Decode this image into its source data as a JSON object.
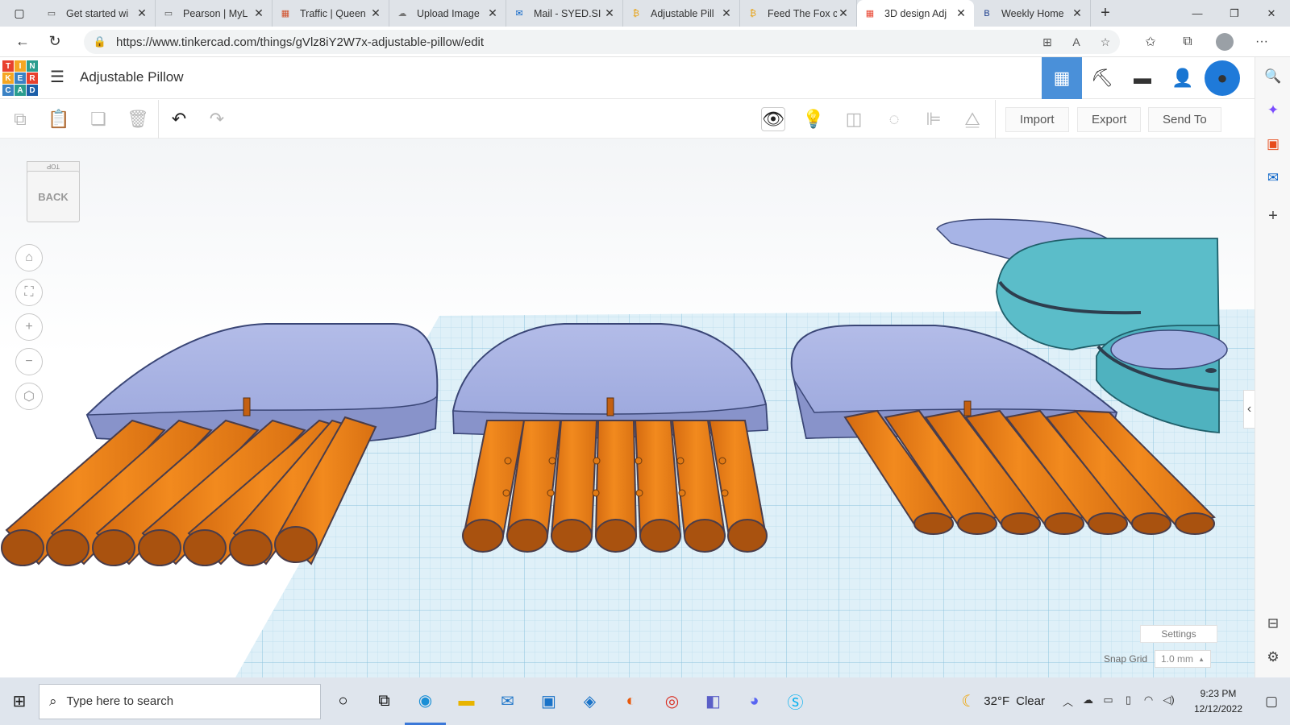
{
  "browser": {
    "tabs": [
      {
        "title": "Get started wi",
        "icon": "page-icon",
        "active": false
      },
      {
        "title": "Pearson | MyL",
        "icon": "page-icon",
        "active": false
      },
      {
        "title": "Traffic | Queen",
        "icon": "microsoft-icon",
        "active": false
      },
      {
        "title": "Upload Image",
        "icon": "cloud-icon",
        "active": false
      },
      {
        "title": "Mail - SYED.SI",
        "icon": "outlook-icon",
        "active": false
      },
      {
        "title": "Adjustable Pill",
        "icon": "coin-icon",
        "active": false
      },
      {
        "title": "Feed The Fox c",
        "icon": "coin-icon",
        "active": false
      },
      {
        "title": "3D design Adj",
        "icon": "tinkercad-icon",
        "active": true
      },
      {
        "title": "Weekly Home",
        "icon": "blackboard-icon",
        "active": false
      }
    ],
    "url": "https://www.tinkercad.com/things/gVlz8iY2W7x-adjustable-pillow/edit"
  },
  "app": {
    "logo_letters": [
      "T",
      "I",
      "N",
      "K",
      "E",
      "R",
      "C",
      "A",
      "D"
    ],
    "logo_colors": [
      "#e8412d",
      "#f5a623",
      "#2a9d8f",
      "#f5a623",
      "#3b82c4",
      "#e8412d",
      "#3b82c4",
      "#2a9d8f",
      "#1c5fa8"
    ],
    "design_title": "Adjustable Pillow"
  },
  "toolbar": {
    "import_label": "Import",
    "export_label": "Export",
    "send_to_label": "Send To"
  },
  "viewport": {
    "viewcube_front": "BACK",
    "viewcube_top": "TOP",
    "settings_label": "Settings",
    "snap_grid_label": "Snap Grid",
    "snap_grid_value": "1.0 mm"
  },
  "taskbar": {
    "search_placeholder": "Type here to search",
    "weather_temp": "32°F",
    "weather_cond": "Clear",
    "time": "9:23 PM",
    "date": "12/12/2022"
  }
}
